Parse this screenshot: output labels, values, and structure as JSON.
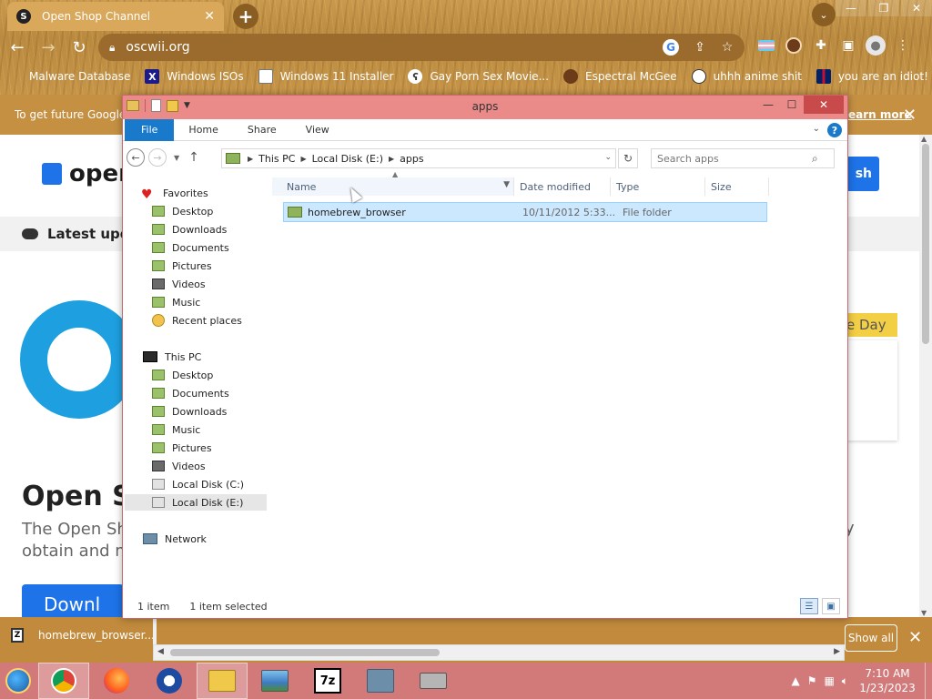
{
  "chrome": {
    "tab_title": "Open Shop Channel",
    "tab_favicon": "S",
    "url": "oscwii.org",
    "bookmarks": [
      {
        "label": "Malware Database",
        "icon": "blank-icon"
      },
      {
        "label": "Windows ISOs",
        "icon": "x-icon"
      },
      {
        "label": "Windows 11 Installer",
        "icon": "image-icon"
      },
      {
        "label": "Gay Porn Sex Movie...",
        "icon": "bear-icon"
      },
      {
        "label": "Espectral McGee",
        "icon": "face-icon"
      },
      {
        "label": "uhhh anime shit",
        "icon": "anime-icon"
      },
      {
        "label": "you are an idiot!",
        "icon": "uk-flag-icon"
      }
    ]
  },
  "page": {
    "infobar_text": "To get future Google",
    "infobar_link": "earn more",
    "logo_text": "open",
    "search_label": "sh",
    "latest_text": "Latest upd",
    "eday_text": "e Day",
    "title": "Open S",
    "desc_line1": "The Open Sh",
    "desc_line2": "obtain and m",
    "desc_tail": "y",
    "download_label": "Downl"
  },
  "downloads": {
    "item_label": "homebrew_browser...",
    "item_icon": "Z",
    "show_all": "Show all"
  },
  "explorer": {
    "title": "apps",
    "ribbon_tabs": [
      "File",
      "Home",
      "Share",
      "View"
    ],
    "breadcrumbs": [
      "This PC",
      "Local Disk (E:)",
      "apps"
    ],
    "search_placeholder": "Search apps",
    "columns": {
      "name": "Name",
      "date": "Date modified",
      "type": "Type",
      "size": "Size"
    },
    "nav": {
      "favorites": "Favorites",
      "fav_items": [
        "Desktop",
        "Downloads",
        "Documents",
        "Pictures",
        "Videos",
        "Music",
        "Recent places"
      ],
      "this_pc": "This PC",
      "pc_items": [
        "Desktop",
        "Documents",
        "Downloads",
        "Music",
        "Pictures",
        "Videos",
        "Local Disk (C:)",
        "Local Disk (E:)"
      ],
      "network": "Network"
    },
    "file": {
      "name": "homebrew_browser",
      "date": "10/11/2012 5:33...",
      "type": "File folder"
    },
    "status": {
      "count": "1 item",
      "selected": "1 item selected"
    }
  },
  "taskbar": {
    "seven_zip": "7z",
    "time": "7:10 AM",
    "date": "1/23/2023"
  }
}
